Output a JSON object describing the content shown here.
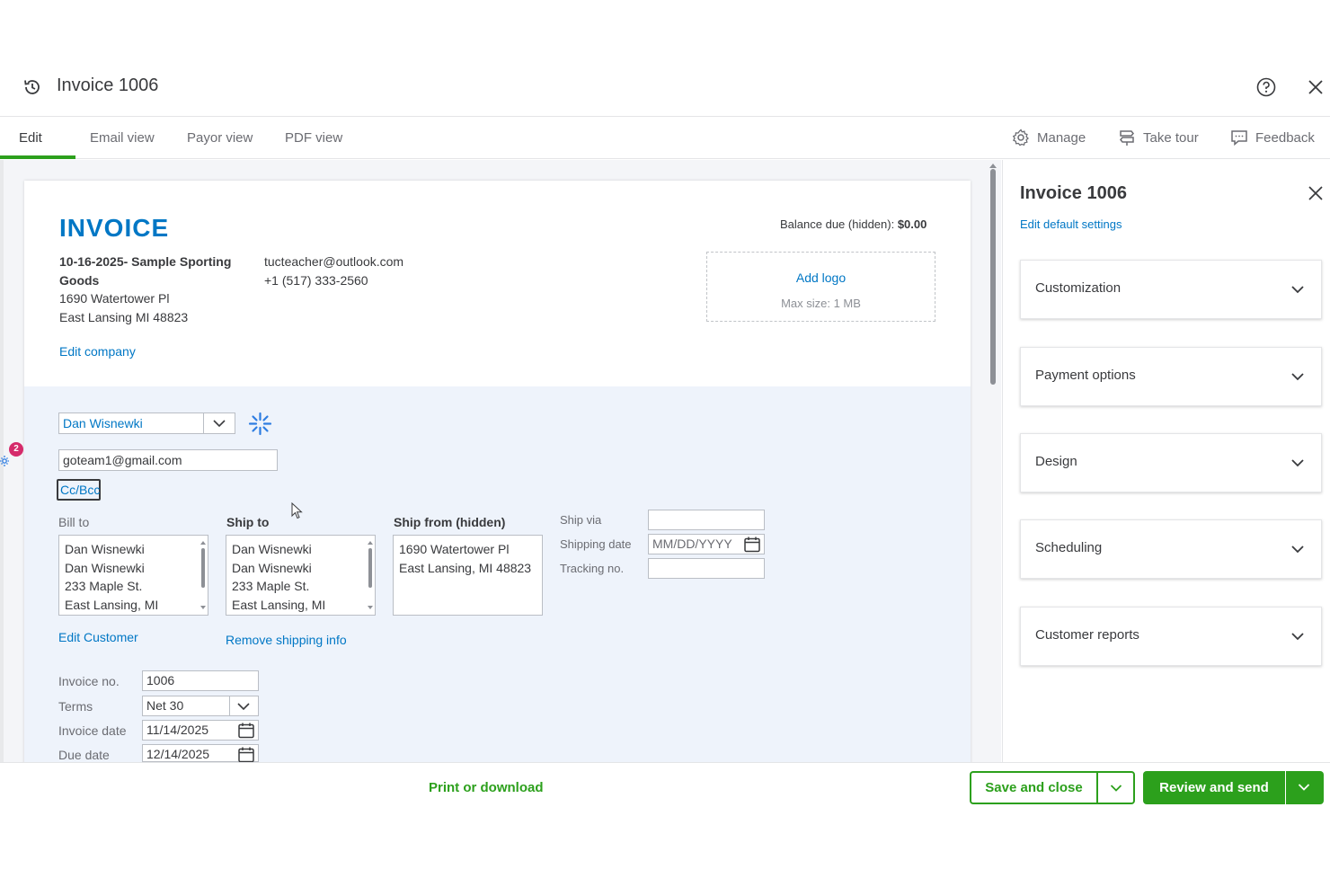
{
  "window": {
    "title": "Invoice 1006"
  },
  "tabs": [
    {
      "label": "Edit",
      "active": true
    },
    {
      "label": "Email view",
      "active": false
    },
    {
      "label": "Payor view",
      "active": false
    },
    {
      "label": "PDF view",
      "active": false
    }
  ],
  "toolbar": {
    "manage": "Manage",
    "take_tour": "Take tour",
    "feedback": "Feedback"
  },
  "invoice": {
    "heading": "INVOICE",
    "balance_label": "Balance due (hidden):",
    "balance_value": "$0.00",
    "company": {
      "name": "10-16-2025- Sample Sporting Goods",
      "street": "1690 Watertower Pl",
      "city": "East Lansing MI 48823",
      "email": "tucteacher@outlook.com",
      "phone": "+1 (517) 333-2560",
      "edit_link": "Edit company"
    },
    "logo": {
      "add": "Add logo",
      "max": "Max size: 1 MB"
    },
    "customer": {
      "name": "Dan Wisnewki",
      "email": "goteam1@gmail.com",
      "ccbcc": "Cc/Bcc",
      "edit_link": "Edit Customer",
      "remove_shipping": "Remove shipping info"
    },
    "bill_to": {
      "label": "Bill to",
      "lines": [
        "Dan Wisnewki",
        "Dan Wisnewki",
        "233 Maple St.",
        "East Lansing, MI"
      ]
    },
    "ship_to": {
      "label": "Ship to",
      "lines": [
        "Dan Wisnewki",
        "Dan Wisnewki",
        "233 Maple St.",
        "East Lansing, MI"
      ]
    },
    "ship_from": {
      "label": "Ship from (hidden)",
      "lines": [
        "1690 Watertower Pl",
        "East Lansing, MI 48823"
      ]
    },
    "shipping": {
      "ship_via_label": "Ship via",
      "ship_via_value": "",
      "shipping_date_label": "Shipping date",
      "shipping_date_placeholder": "MM/DD/YYYY",
      "tracking_label": "Tracking no.",
      "tracking_value": ""
    },
    "details": {
      "invoice_no_label": "Invoice no.",
      "invoice_no_value": "1006",
      "terms_label": "Terms",
      "terms_value": "Net 30",
      "invoice_date_label": "Invoice date",
      "invoice_date_value": "11/14/2025",
      "due_date_label": "Due date",
      "due_date_value": "12/14/2025"
    }
  },
  "panel": {
    "title": "Invoice 1006",
    "link": "Edit default settings",
    "sections": [
      "Customization",
      "Payment options",
      "Design",
      "Scheduling",
      "Customer reports"
    ]
  },
  "footer": {
    "print": "Print or download",
    "save": "Save and close",
    "review": "Review and send"
  },
  "badge": {
    "count": "2"
  },
  "colors": {
    "brand_green": "#2ca01c",
    "link_blue": "#0077c5",
    "notification": "#d52b6b"
  }
}
